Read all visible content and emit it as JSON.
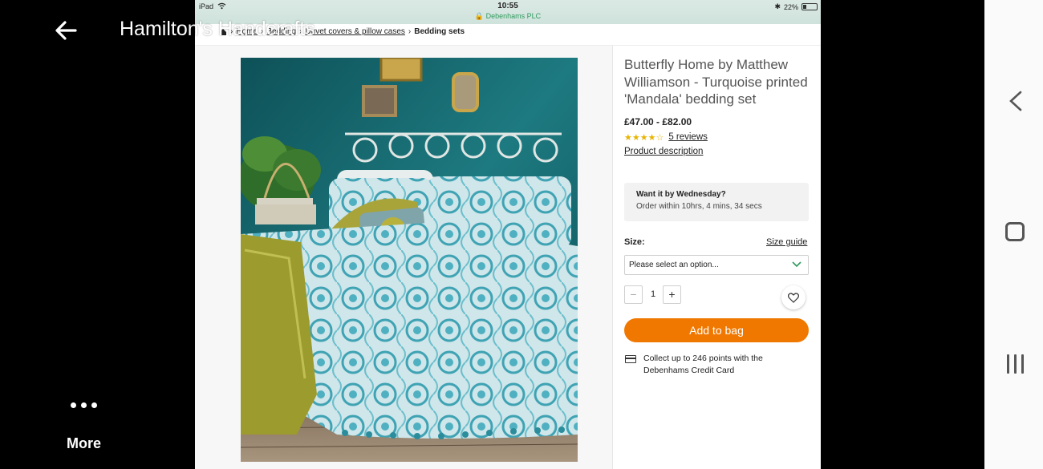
{
  "viewer": {
    "title": "Hamilton's Handcrafts",
    "more_label": "More"
  },
  "status_bar": {
    "device": "iPad",
    "time": "10:55",
    "site": "🔒 Debenhams PLC",
    "battery": "22%",
    "bluetooth": "✱"
  },
  "breadcrumb": {
    "items": [
      "Home",
      "Bedding",
      "Duvet covers & pillow cases"
    ],
    "current": "Bedding sets"
  },
  "product": {
    "title": "Butterfly Home by Matthew Williamson - Turquoise printed 'Mandala' bedding set",
    "price": "£47.00 - £82.00",
    "rating": 3.5,
    "stars": "★★★★☆",
    "reviews_label": "5 reviews",
    "description_link": "Product description"
  },
  "delivery": {
    "title": "Want it by Wednesday?",
    "subtitle": "Order within 10hrs, 4 mins, 34 secs"
  },
  "size": {
    "label": "Size:",
    "guide_link": "Size guide",
    "select_value": "Please select an option..."
  },
  "quantity": {
    "minus": "−",
    "value": "1",
    "plus": "+"
  },
  "add_to_bag_label": "Add to bag",
  "credit": {
    "text": "Collect up to 246 points with the Debenhams Credit Card"
  },
  "colors": {
    "accent_orange": "#f07800",
    "secure_green": "#2f9a5d",
    "star_yellow": "#e8b400"
  },
  "icons": {
    "viewer_back": "arrow-left-icon",
    "more": "more-dots-icon",
    "nav_back": "chevron-left-icon",
    "nav_home": "rounded-square-icon",
    "nav_recent": "recent-apps-icon",
    "wishlist": "heart-icon",
    "select": "chevron-down-icon",
    "credit": "credit-card-icon"
  }
}
